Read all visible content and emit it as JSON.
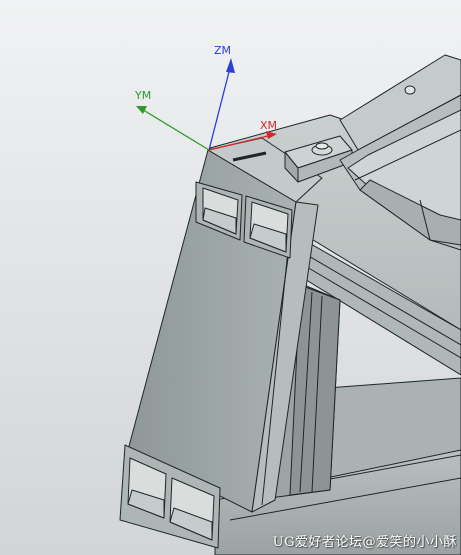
{
  "viewport": {
    "background_top": "#f1f2f3",
    "background_bottom": "#d2d5d8",
    "model_color": "#a3acab",
    "edge_color": "#1f2628"
  },
  "triad": {
    "z_label": "ZM",
    "y_label": "YM",
    "x_label": "XM",
    "z_color": "#2a3fd6",
    "y_color": "#2e9a2e",
    "x_color": "#d12a2a"
  },
  "watermark": "UG爱好者论坛@爱笑的小小酥"
}
